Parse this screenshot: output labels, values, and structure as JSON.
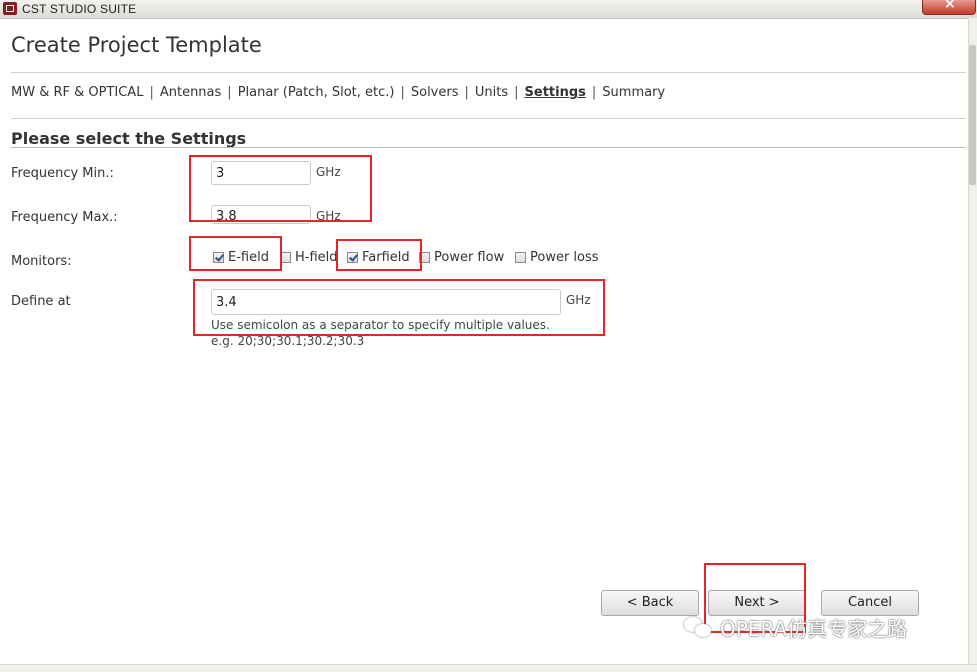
{
  "window": {
    "title": "CST STUDIO SUITE"
  },
  "page": {
    "title": "Create Project Template"
  },
  "breadcrumb": {
    "items": [
      {
        "label": "MW & RF & OPTICAL",
        "active": false
      },
      {
        "label": "Antennas",
        "active": false
      },
      {
        "label": "Planar (Patch, Slot, etc.)",
        "active": false
      },
      {
        "label": "Solvers",
        "active": false
      },
      {
        "label": "Units",
        "active": false
      },
      {
        "label": "Settings",
        "active": true
      },
      {
        "label": "Summary",
        "active": false
      }
    ],
    "separator": "|"
  },
  "settings": {
    "section_title": "Please select the Settings",
    "freq_min": {
      "label": "Frequency Min.:",
      "value": "3",
      "unit": "GHz"
    },
    "freq_max": {
      "label": "Frequency Max.:",
      "value": "3.8",
      "unit": "GHz"
    },
    "monitors": {
      "label": "Monitors:",
      "items": [
        {
          "label": "E-field",
          "checked": true
        },
        {
          "label": "H-field",
          "checked": false
        },
        {
          "label": "Farfield",
          "checked": true
        },
        {
          "label": "Power flow",
          "checked": false
        },
        {
          "label": "Power loss",
          "checked": false
        }
      ]
    },
    "define_at": {
      "label": "Define at",
      "value": "3.4",
      "unit": "GHz",
      "hint": "Use semicolon as a separator to specify multiple values.",
      "example": "e.g. 20;30;30.1;30.2;30.3"
    }
  },
  "buttons": {
    "back": "< Back",
    "next": "Next >",
    "cancel": "Cancel"
  },
  "watermark": {
    "text": "OPERA仿真专家之路"
  },
  "colors": {
    "annotation": "#e8232a",
    "brand": "#8b1a23"
  }
}
